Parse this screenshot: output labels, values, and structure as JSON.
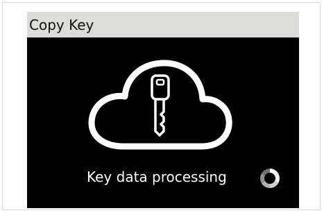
{
  "screen": {
    "title": "Copy Key",
    "status_text": "Key data processing"
  },
  "icons": {
    "main": "cloud-key-icon",
    "progress": "loading-spinner-icon"
  },
  "colors": {
    "title_bar_bg": "#dcdcd8",
    "screen_bg": "#000000",
    "foreground": "#ffffff"
  }
}
